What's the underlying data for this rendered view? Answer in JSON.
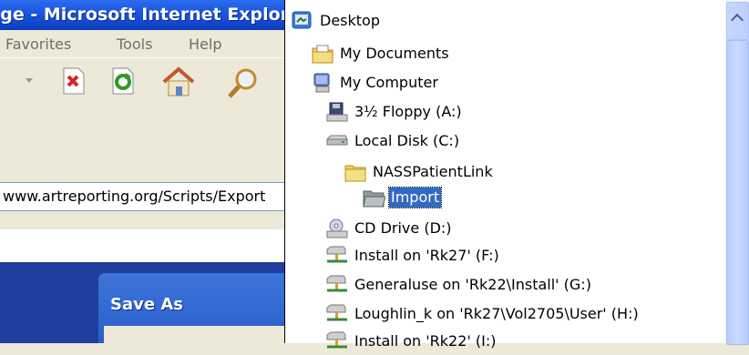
{
  "browser": {
    "title": "Page - Microsoft Internet Explorer",
    "menu": [
      "Favorites",
      "Tools",
      "Help"
    ],
    "address": "www.artreporting.org/Scripts/Export"
  },
  "dialog": {
    "title": "Save As"
  },
  "folder_list": {
    "items": [
      {
        "label": "Desktop",
        "icon": "desktop-icon"
      },
      {
        "label": "My Documents",
        "icon": "my-documents-icon"
      },
      {
        "label": "My Computer",
        "icon": "my-computer-icon"
      },
      {
        "label": "3½ Floppy (A:)",
        "icon": "floppy-drive-icon"
      },
      {
        "label": "Local Disk (C:)",
        "icon": "hard-disk-icon"
      },
      {
        "label": "NASSPatientLink",
        "icon": "folder-icon"
      },
      {
        "label": "Import",
        "icon": "open-folder-icon",
        "selected": true
      },
      {
        "label": "CD Drive (D:)",
        "icon": "cd-drive-icon"
      },
      {
        "label": "Install on 'Rk27' (F:)",
        "icon": "network-drive-icon"
      },
      {
        "label": "Generaluse on 'Rk22\\Install' (G:)",
        "icon": "network-drive-icon"
      },
      {
        "label": "Loughlin_k on 'Rk27\\Vol2705\\User' (H:)",
        "icon": "network-drive-icon"
      },
      {
        "label": "Install on 'Rk22' (I:)",
        "icon": "network-drive-icon"
      }
    ]
  },
  "colors": {
    "selection": "#316ac5",
    "title_bar": "#1a58de",
    "window_face": "#ece9d8"
  }
}
